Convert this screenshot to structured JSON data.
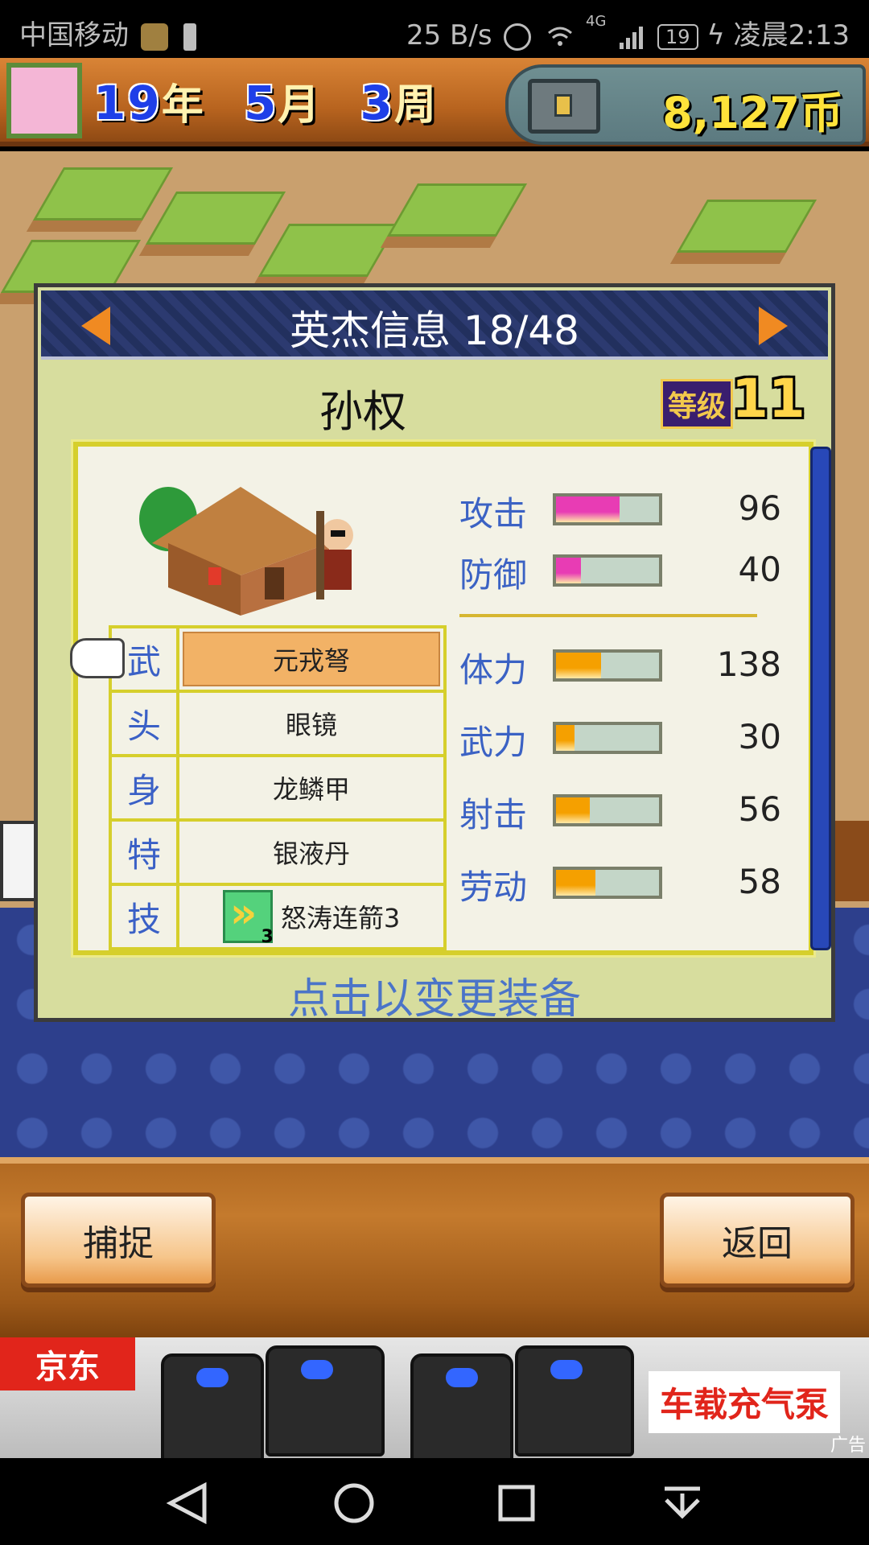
{
  "status_bar": {
    "carrier": "中国移动",
    "net_speed": "25 B/s",
    "network": "4G",
    "battery": "19",
    "time": "凌晨2:13"
  },
  "top_bar": {
    "year_value": "19",
    "year_unit": "年",
    "month_value": "5",
    "month_unit": "月",
    "week_value": "3",
    "week_unit": "周",
    "coins": "8,127币"
  },
  "dialog": {
    "title": "英杰信息 18/48",
    "hero_name": "孙权",
    "level_label": "等级",
    "level_value": "11",
    "equipment": [
      {
        "slot": "武",
        "item": "元戎弩",
        "selected": true
      },
      {
        "slot": "头",
        "item": "眼镜",
        "selected": false
      },
      {
        "slot": "身",
        "item": "龙鳞甲",
        "selected": false
      },
      {
        "slot": "特",
        "item": "银液丹",
        "selected": false
      },
      {
        "slot": "技",
        "item": "怒涛连箭3",
        "selected": false
      }
    ],
    "stats": [
      {
        "label": "攻击",
        "value": "96",
        "fill_fraction": 0.62,
        "color": "#e83cb4"
      },
      {
        "label": "防御",
        "value": "40",
        "fill_fraction": 0.24,
        "color": "#e83cb4"
      },
      {
        "label": "体力",
        "value": "138",
        "fill_fraction": 0.44,
        "color": "#f5a000"
      },
      {
        "label": "武力",
        "value": "30",
        "fill_fraction": 0.18,
        "color": "#f5a000"
      },
      {
        "label": "射击",
        "value": "56",
        "fill_fraction": 0.33,
        "color": "#f5a000"
      },
      {
        "label": "劳动",
        "value": "58",
        "fill_fraction": 0.38,
        "color": "#f5a000"
      }
    ],
    "hint": "点击以变更装备"
  },
  "buttons": {
    "capture": "捕捉",
    "back": "返回"
  },
  "ad": {
    "brand": "京东",
    "slogan": "车载充气泵",
    "tag": "广告"
  },
  "nav_icons": [
    "back-triangle-icon",
    "home-circle-icon",
    "recent-square-icon",
    "dropdown-icon"
  ]
}
